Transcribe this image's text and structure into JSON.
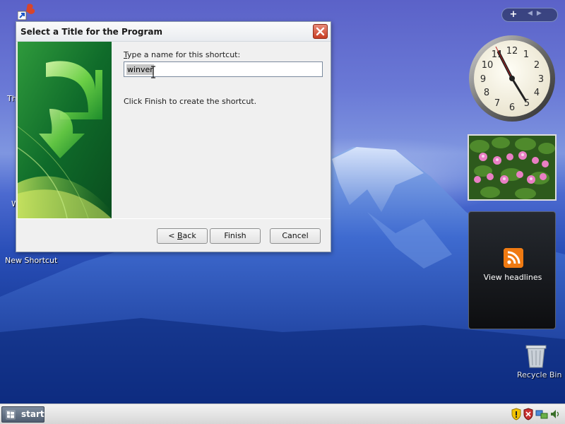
{
  "desktop": {
    "new_shortcut_label": "New Shortcut",
    "recycle_bin_label": "Recycle Bin",
    "partial_label_th": "Th",
    "partial_label_w": "W"
  },
  "dialog": {
    "title": "Select a Title for the Program",
    "field_label_hotkey": "T",
    "field_label_rest": "ype a name for this shortcut:",
    "input_value": "winver",
    "hint": "Click Finish to create the shortcut.",
    "buttons": {
      "back_prefix": "< ",
      "back_hotkey": "B",
      "back_rest": "ack",
      "finish": "Finish",
      "cancel": "Cancel"
    }
  },
  "gadgets": {
    "add_label": "+",
    "feed_headline": "View headlines"
  },
  "taskbar": {
    "start_label": "start"
  },
  "colors": {
    "close_button": "#c83e24",
    "rss_orange": "#f07a12",
    "desktop_blue": "#2a4fb8"
  }
}
